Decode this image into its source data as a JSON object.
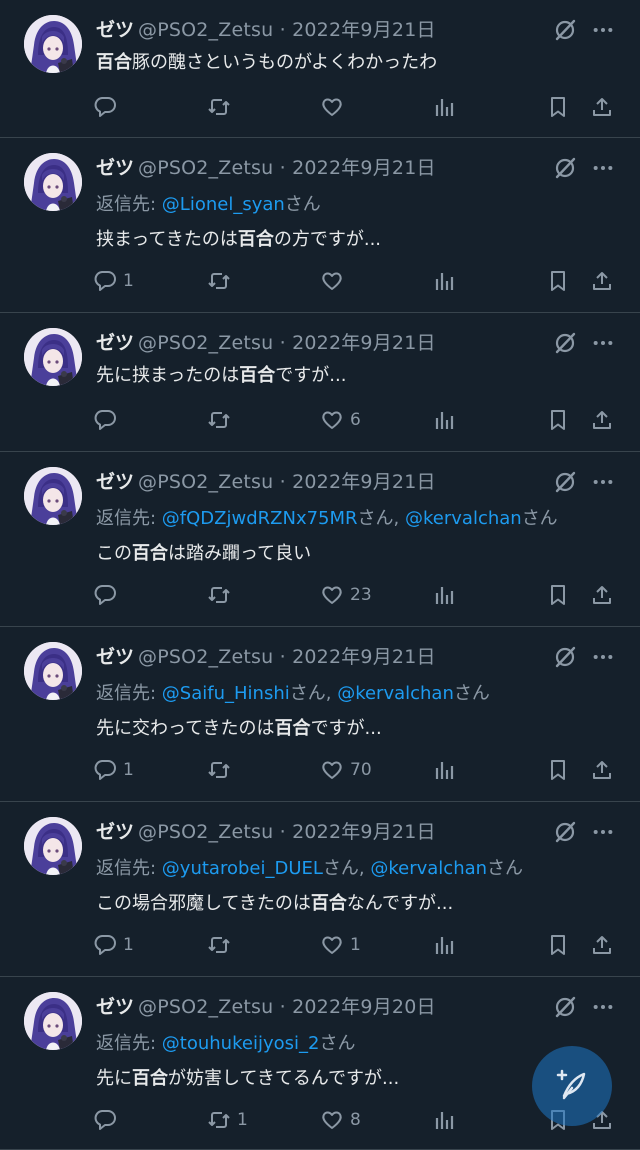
{
  "tweets": [
    {
      "name": "ゼツ",
      "handle_date": "@PSO2_Zetsu · 2022年9月21日",
      "reply_prefix": "",
      "mentions": [],
      "text_parts": [
        {
          "t": "百合",
          "b": true
        },
        {
          "t": "豚の醜さというものがよくわかったわ",
          "b": false
        }
      ],
      "counts": {
        "reply": "",
        "retweet": "",
        "like": ""
      }
    },
    {
      "name": "ゼツ",
      "handle_date": "@PSO2_Zetsu · 2022年9月21日",
      "reply_prefix": "返信先: ",
      "mentions": [
        "@Lionel_syan"
      ],
      "text_parts": [
        {
          "t": "挟まってきたのは",
          "b": false
        },
        {
          "t": "百合",
          "b": true
        },
        {
          "t": "の方ですが...",
          "b": false
        }
      ],
      "counts": {
        "reply": "1",
        "retweet": "",
        "like": ""
      }
    },
    {
      "name": "ゼツ",
      "handle_date": "@PSO2_Zetsu · 2022年9月21日",
      "reply_prefix": "",
      "mentions": [],
      "text_parts": [
        {
          "t": "先に挟まったのは",
          "b": false
        },
        {
          "t": "百合",
          "b": true
        },
        {
          "t": "ですが...",
          "b": false
        }
      ],
      "counts": {
        "reply": "",
        "retweet": "",
        "like": "6"
      }
    },
    {
      "name": "ゼツ",
      "handle_date": "@PSO2_Zetsu · 2022年9月21日",
      "reply_prefix": "返信先: ",
      "mentions": [
        "@fQDZjwdRZNx75MR",
        "@kervalchan"
      ],
      "text_parts": [
        {
          "t": "この",
          "b": false
        },
        {
          "t": "百合",
          "b": true
        },
        {
          "t": "は踏み躙って良い",
          "b": false
        }
      ],
      "counts": {
        "reply": "",
        "retweet": "",
        "like": "23"
      }
    },
    {
      "name": "ゼツ",
      "handle_date": "@PSO2_Zetsu · 2022年9月21日",
      "reply_prefix": "返信先: ",
      "mentions": [
        "@Saifu_Hinshi",
        "@kervalchan"
      ],
      "text_parts": [
        {
          "t": "先に交わってきたのは",
          "b": false
        },
        {
          "t": "百合",
          "b": true
        },
        {
          "t": "ですが...",
          "b": false
        }
      ],
      "counts": {
        "reply": "1",
        "retweet": "",
        "like": "70"
      }
    },
    {
      "name": "ゼツ",
      "handle_date": "@PSO2_Zetsu · 2022年9月21日",
      "reply_prefix": "返信先: ",
      "mentions": [
        "@yutarobei_DUEL",
        "@kervalchan"
      ],
      "text_parts": [
        {
          "t": "この場合邪魔してきたのは",
          "b": false
        },
        {
          "t": "百合",
          "b": true
        },
        {
          "t": "なんですが...",
          "b": false
        }
      ],
      "counts": {
        "reply": "1",
        "retweet": "",
        "like": "1"
      }
    },
    {
      "name": "ゼツ",
      "handle_date": "@PSO2_Zetsu · 2022年9月20日",
      "reply_prefix": "返信先: ",
      "mentions": [
        "@touhukeijyosi_2"
      ],
      "text_parts": [
        {
          "t": "先に",
          "b": false
        },
        {
          "t": "百合",
          "b": true
        },
        {
          "t": "が妨害してきてるんですが...",
          "b": false
        }
      ],
      "counts": {
        "reply": "",
        "retweet": "1",
        "like": "8"
      }
    }
  ],
  "mention_suffix": "さん",
  "mention_separator": ", ",
  "icons": {
    "top": [
      "grok-icon",
      "more-icon"
    ],
    "actions": [
      "reply-icon",
      "retweet-icon",
      "like-icon",
      "views-icon",
      "bookmark-icon",
      "share-icon"
    ],
    "fab": "compose-icon"
  },
  "colors": {
    "background": "#15202b",
    "text": "#e7e9ea",
    "muted": "#8b98a5",
    "accent": "#1d9bf0",
    "divider": "#38444d"
  }
}
